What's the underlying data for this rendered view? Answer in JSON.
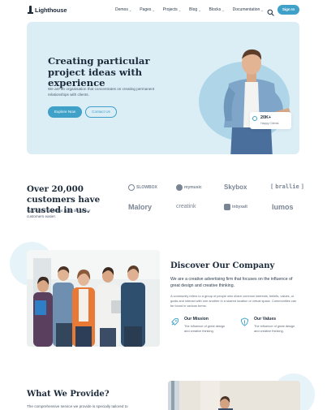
{
  "nav": {
    "logo": "Lighthouse",
    "items": [
      "Demos",
      "Pages",
      "Projects",
      "Blog",
      "Blocks",
      "Documentation"
    ],
    "signin": "Sign In"
  },
  "hero": {
    "title": "Creating particular project ideas with experience",
    "description": "We are an organisation that concentrates on creating permanent relationships with clients.",
    "explore_button": "Explore Now",
    "contact_button": "Contact Us",
    "stat_value": "20K+",
    "stat_label": "Happy Clients"
  },
  "customers": {
    "title": "Over 20,000 customers have trusted in us.",
    "description": "We provide ideas that make life for our customers easier.",
    "brands": [
      "SLOWBOX",
      "mymusic",
      "Skybox",
      "brallie",
      "Malory",
      "creatink",
      "inbyxalt",
      "lumos"
    ]
  },
  "discover": {
    "title": "Discover Our Company",
    "lead": "We are a creative advertising firm that focuses on the influence of great design and creative thinking.",
    "body": "A community refers to a group of people who share common interests, beliefs, values, or goals and interact with one another in a shared location or virtual space. Communities can be found in various forms.",
    "mission_title": "Our Mission",
    "mission_desc": "The influence of great design and creative thinking.",
    "values_title": "Our Values",
    "values_desc": "The influence of great design and creative thinking."
  },
  "provide": {
    "title": "What We Provide?",
    "description": "The comprehensive service we provide is specially tailored to"
  },
  "colors": {
    "accent": "#3fa0c8",
    "hero_bg": "#dbeef6",
    "circle": "#aed6e8"
  }
}
